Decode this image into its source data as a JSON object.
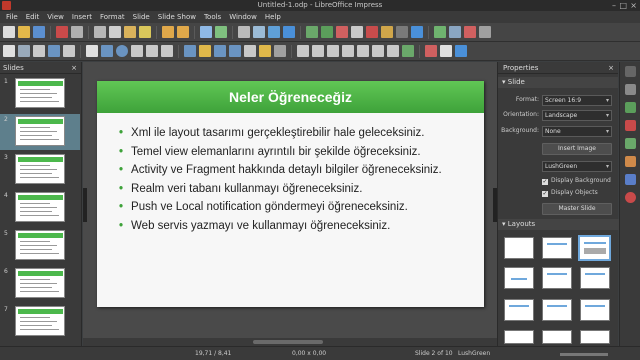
{
  "window": {
    "title": "Untitled-1.odp - LibreOffice Impress"
  },
  "menu": [
    "File",
    "Edit",
    "View",
    "Insert",
    "Format",
    "Slide",
    "Slide Show",
    "Tools",
    "Window",
    "Help"
  ],
  "slides_panel": {
    "title": "Slides",
    "close": "×",
    "count": 7,
    "active_index": 2
  },
  "slide": {
    "title": "Neler Öğreneceğiz",
    "bullets": [
      "Xml ile layout tasarımı gerçekleştirebilir hale geleceksiniz.",
      "Temel view elemanlarını ayrıntılı bir şekilde öğreceksiniz.",
      "Activity ve Fragment hakkında detaylı bilgiler öğreneceksiniz.",
      "Realm veri tabanı kullanmayı öğreneceksiniz.",
      "Push ve Local notification göndermeyi öğreneceksiniz.",
      "Web servis yazmayı ve kullanmayı öğreneceksiniz."
    ],
    "accent_color": "#4cb84c"
  },
  "properties": {
    "title": "Properties",
    "close": "×",
    "slide_section": "Slide",
    "format_label": "Format:",
    "format_value": "Screen 16:9",
    "orientation_label": "Orientation:",
    "orientation_value": "Landscape",
    "background_label": "Background:",
    "background_value": "None",
    "insert_image": "Insert Image",
    "master_value": "LushGreen",
    "display_background": "Display Background",
    "display_objects": "Display Objects",
    "master_slide": "Master Slide",
    "layouts_section": "Layouts"
  },
  "status": {
    "position": "19,71 / 8,41",
    "size": "0,00 x 0,00",
    "slide_of": "Slide 2 of 10",
    "master": "LushGreen"
  }
}
